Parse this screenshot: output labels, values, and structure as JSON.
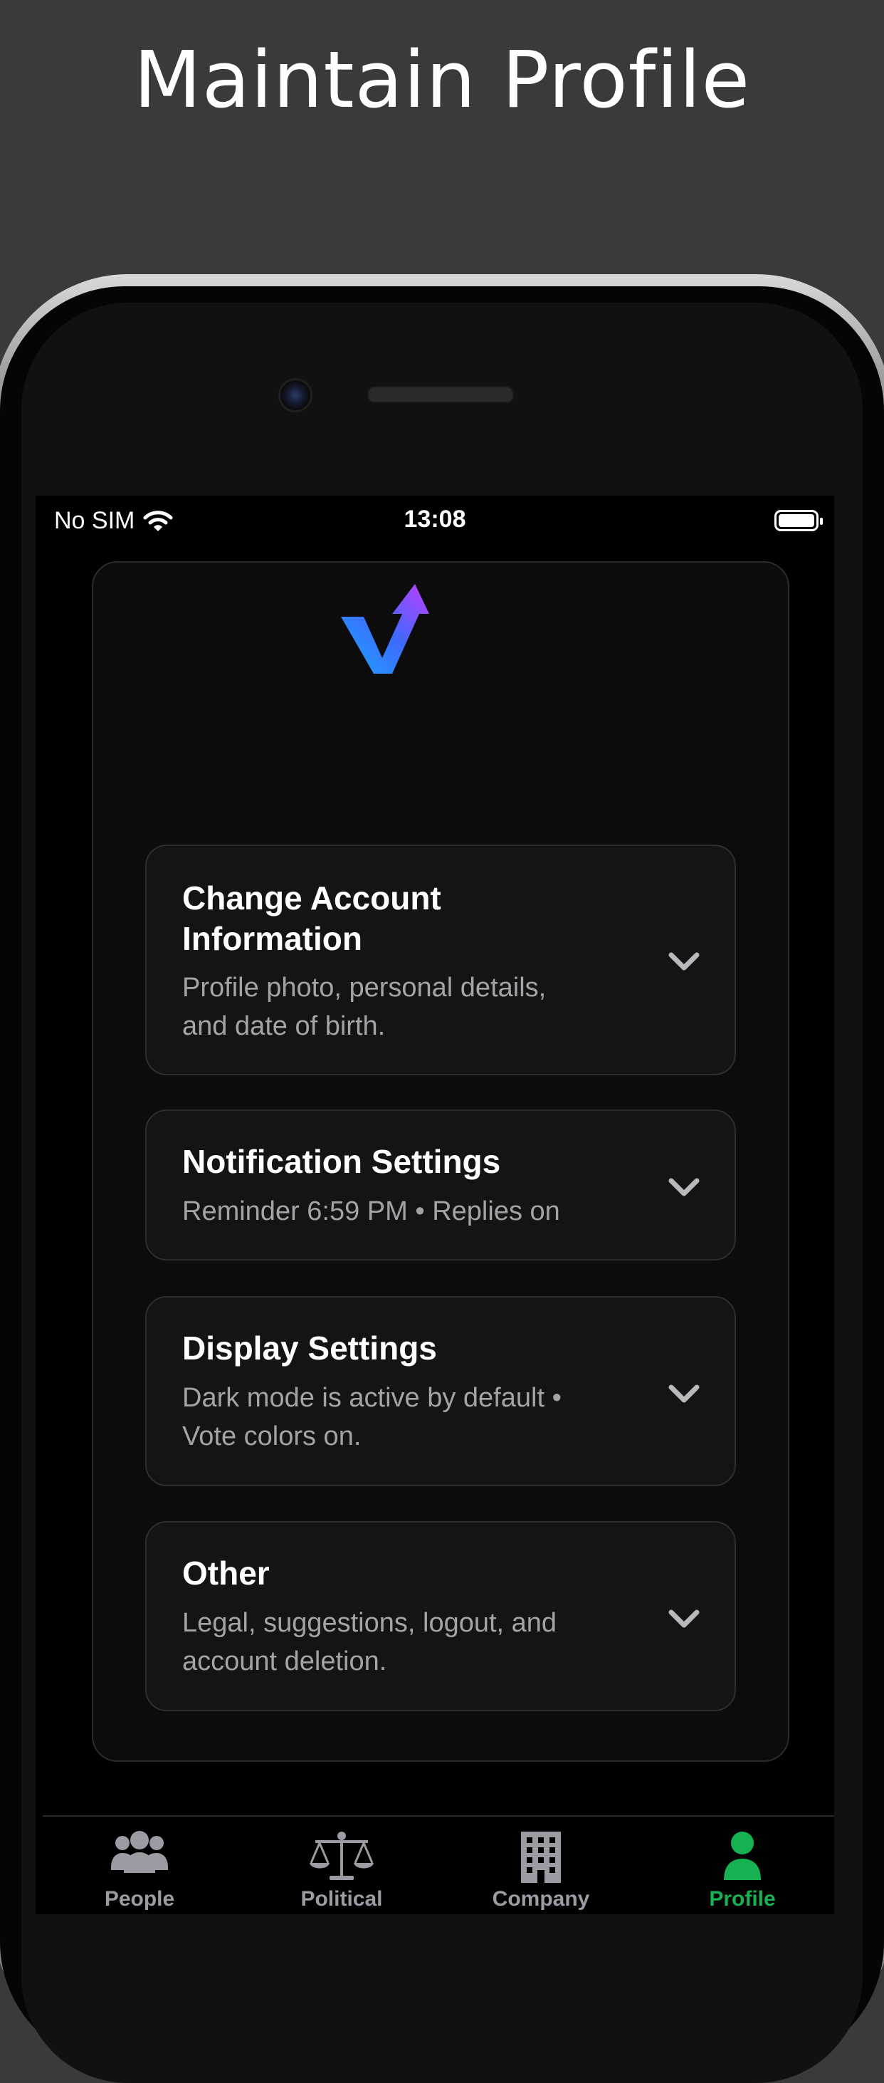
{
  "headline": "Maintain Profile",
  "status_bar": {
    "carrier": "No SIM",
    "time": "13:08"
  },
  "logo": {
    "name": "app-logo",
    "colors": [
      "#2a8bff",
      "#7a3cff",
      "#c040ff"
    ]
  },
  "sections": [
    {
      "title_line1": "Change Account",
      "title_line2": "Information",
      "subtitle_line1": "Profile photo, personal details,",
      "subtitle_line2": "and date of birth."
    },
    {
      "title_line1": "Notification Settings",
      "subtitle_line1": "Reminder 6:59 PM • Replies on"
    },
    {
      "title_line1": "Display Settings",
      "subtitle_line1": "Dark mode is active by default •",
      "subtitle_line2": "Vote colors on."
    },
    {
      "title_line1": "Other",
      "subtitle_line1": "Legal, suggestions, logout, and",
      "subtitle_line2": "account deletion."
    }
  ],
  "tabs": [
    {
      "label": "People",
      "icon": "people-icon",
      "active": false
    },
    {
      "label": "Political",
      "icon": "scales-icon",
      "active": false
    },
    {
      "label": "Company",
      "icon": "building-icon",
      "active": false
    },
    {
      "label": "Profile",
      "icon": "person-icon",
      "active": true
    }
  ],
  "colors": {
    "background": "#3a3a3a",
    "active_tab": "#16b151",
    "inactive_tab": "#9a9ba3"
  }
}
